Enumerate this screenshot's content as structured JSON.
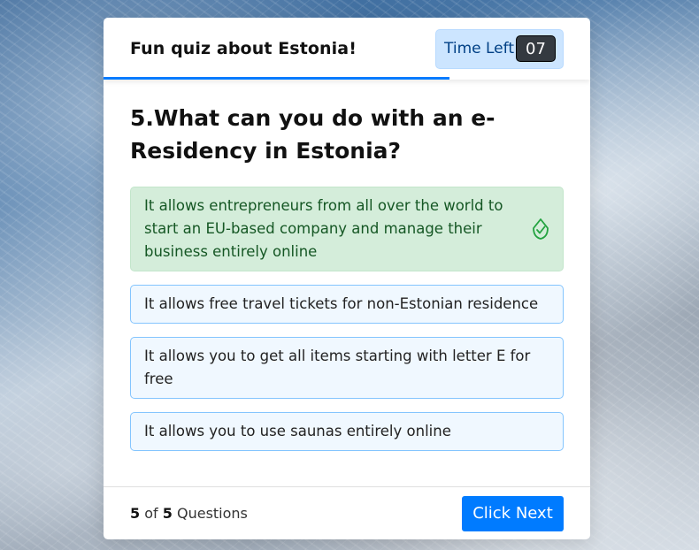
{
  "quiz": {
    "title": "Fun quiz about Estonia!",
    "timer_label": "Time Left",
    "timer_seconds": "07",
    "progress_fraction": 0.71
  },
  "question": {
    "text": "5.What can you do with an e-Residency in Estonia?",
    "options": [
      {
        "text": "It allows entrepreneurs from all over the world to start an EU-based company and manage their business entirely online",
        "state": "correct",
        "icon": "check-circle-icon"
      },
      {
        "text": "It allows free travel tickets for non-Estonian residence",
        "state": "default"
      },
      {
        "text": "It allows you to get all items starting with letter E for free",
        "state": "default"
      },
      {
        "text": "It allows you to use saunas entirely online",
        "state": "default"
      }
    ]
  },
  "footer": {
    "current": "5",
    "of": "of",
    "total": "5",
    "questions_word": "Questions",
    "next_label": "Click Next"
  },
  "colors": {
    "accent": "#007bff",
    "correct_bg": "#d4edda",
    "correct_text": "#155724",
    "option_bg": "#f0f8ff",
    "timer_bg": "#cce5ff"
  }
}
